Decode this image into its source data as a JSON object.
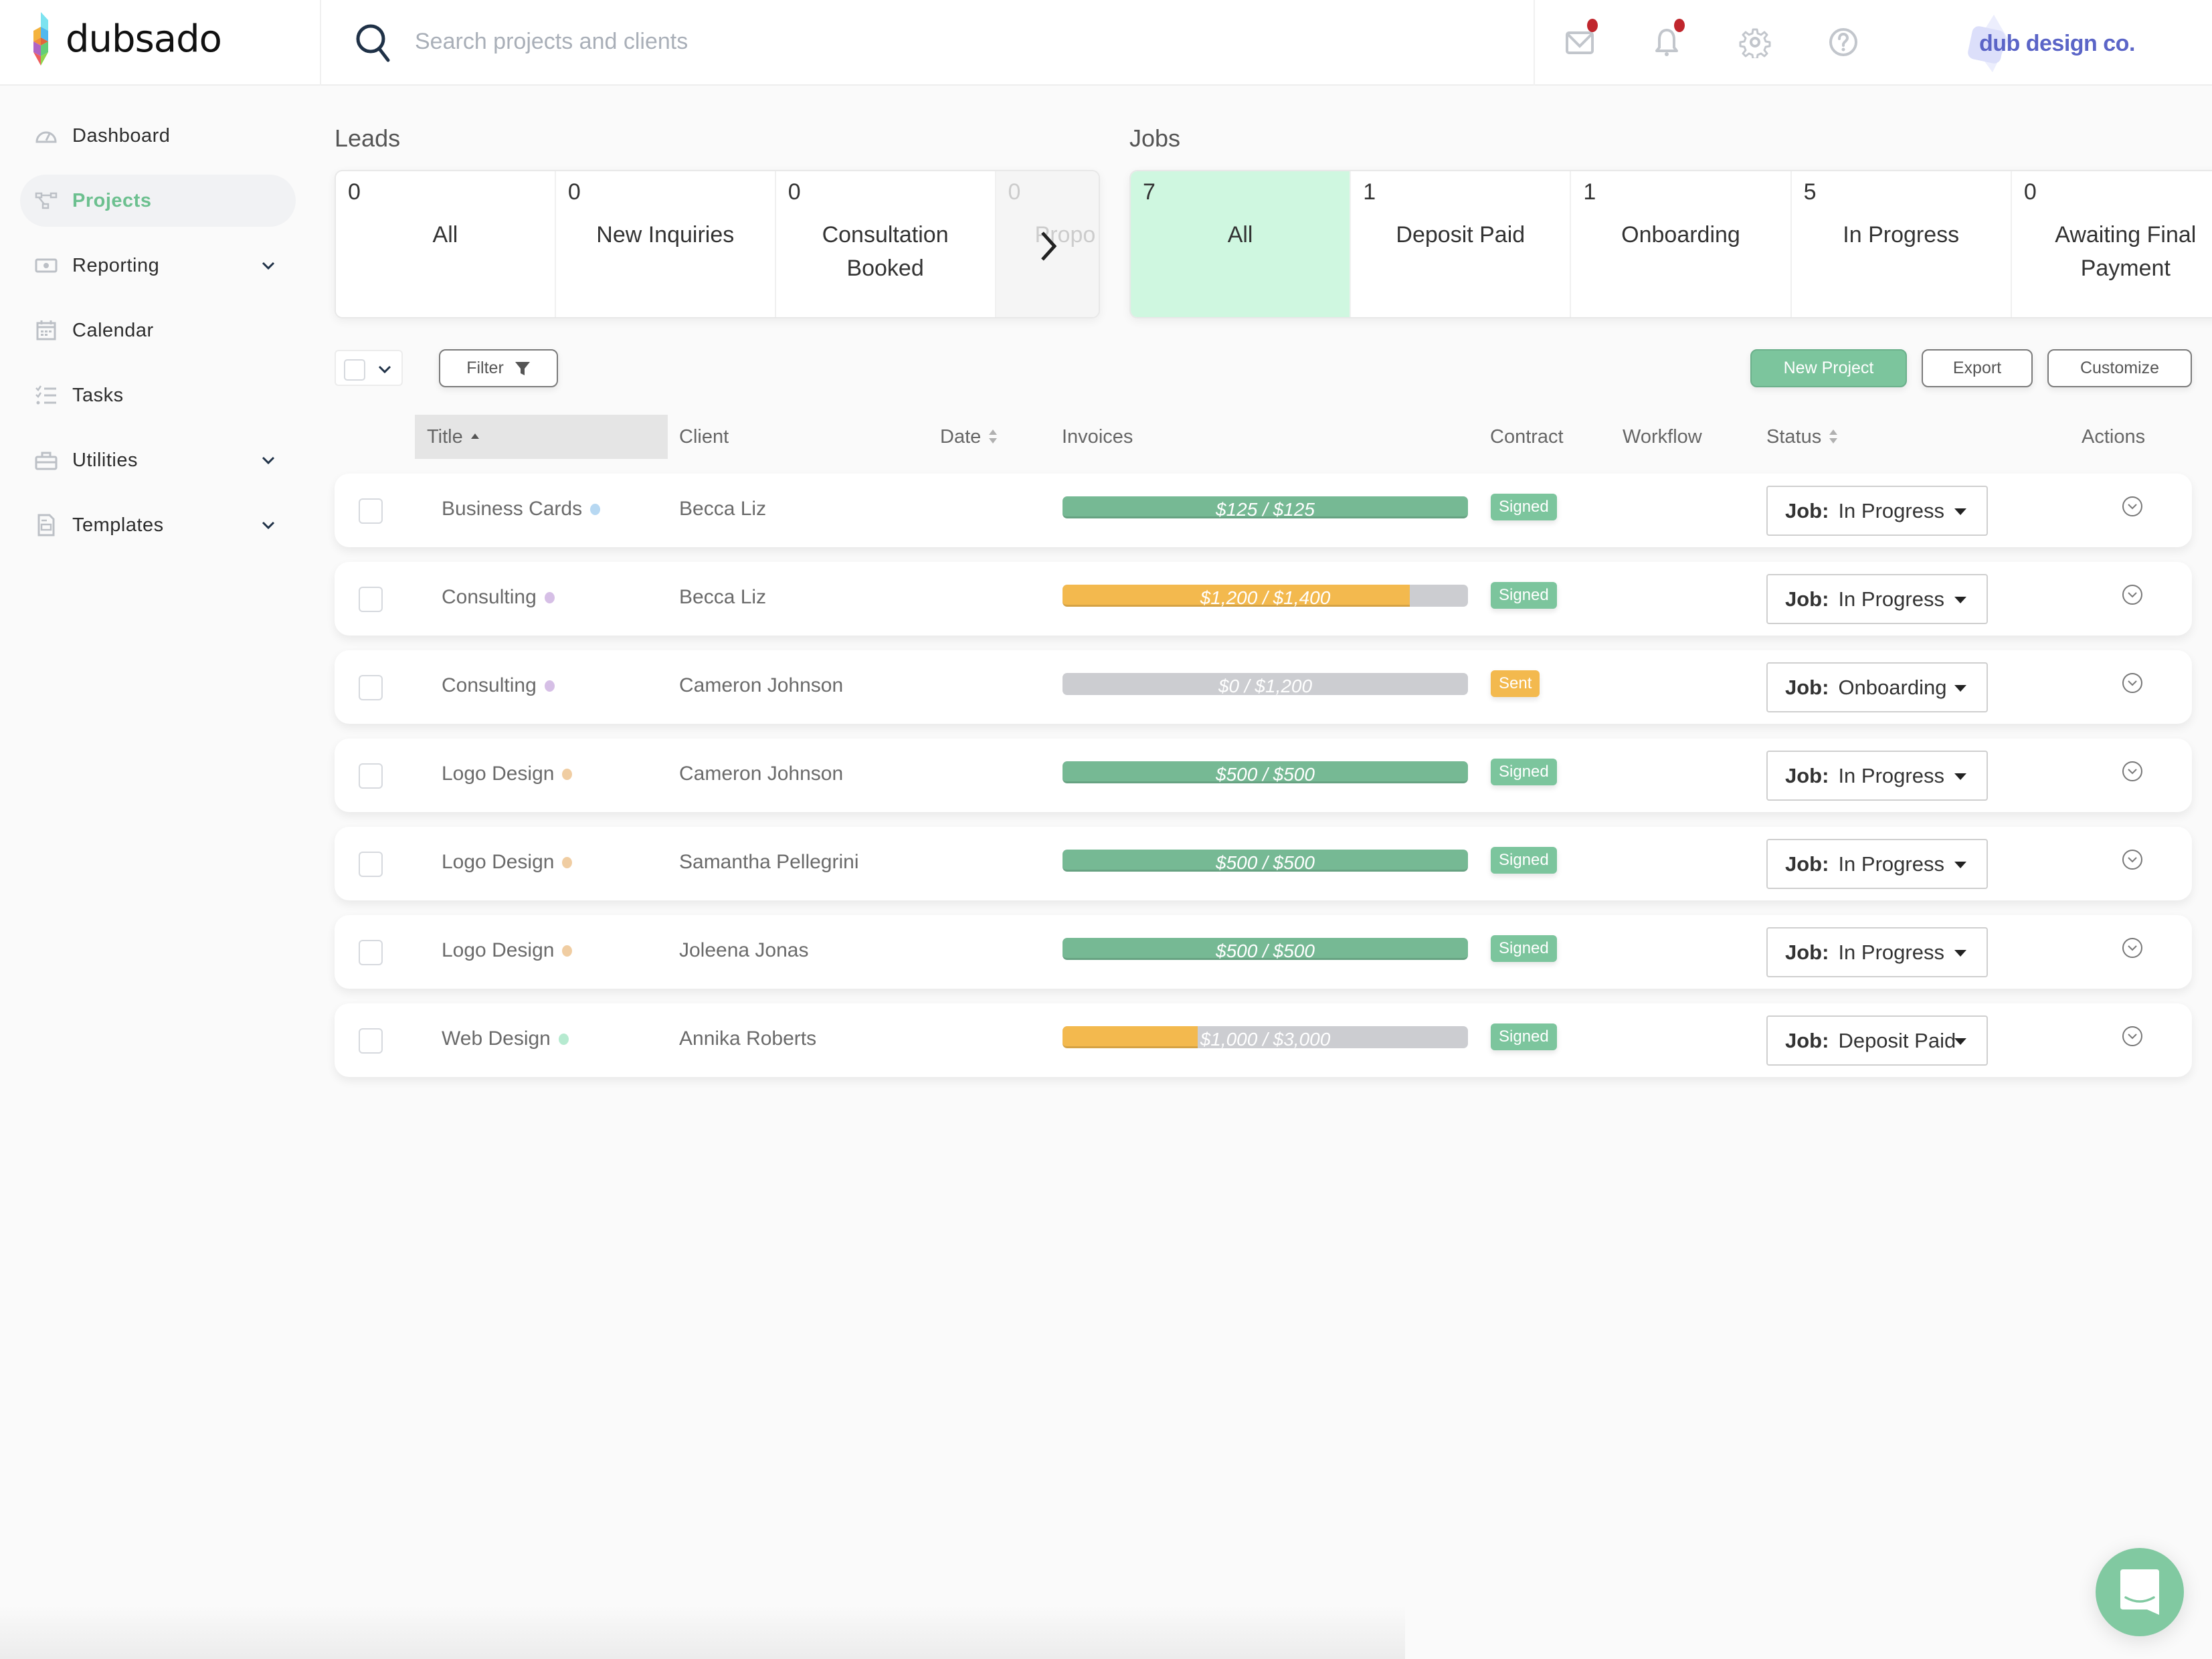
{
  "app": {
    "name": "dubsado",
    "brand_name": "dub design co.",
    "colors": {
      "accent": "#6cc08f",
      "primary_button": "#7cc59d",
      "selected_stage": "#cff7e0",
      "paid_full": "#76b994",
      "paid_partial": "#f3b94e",
      "unpaid": "#cccdd1",
      "notification_dot": "#c0262d",
      "brand_text": "#5b65c7"
    }
  },
  "header": {
    "search": {
      "placeholder": "Search projects and clients",
      "value": ""
    },
    "icons": [
      {
        "name": "mail-icon",
        "has_notification": true
      },
      {
        "name": "bell-icon",
        "has_notification": true
      },
      {
        "name": "gear-icon",
        "has_notification": false
      },
      {
        "name": "help-icon",
        "has_notification": false
      }
    ]
  },
  "sidebar": {
    "items": [
      {
        "label": "Dashboard",
        "icon": "dashboard-icon",
        "active": false,
        "expandable": false
      },
      {
        "label": "Projects",
        "icon": "projects-icon",
        "active": true,
        "expandable": false
      },
      {
        "label": "Reporting",
        "icon": "reporting-icon",
        "active": false,
        "expandable": true
      },
      {
        "label": "Calendar",
        "icon": "calendar-icon",
        "active": false,
        "expandable": false
      },
      {
        "label": "Tasks",
        "icon": "tasks-icon",
        "active": false,
        "expandable": false
      },
      {
        "label": "Utilities",
        "icon": "utilities-icon",
        "active": false,
        "expandable": true
      },
      {
        "label": "Templates",
        "icon": "templates-icon",
        "active": false,
        "expandable": true
      }
    ]
  },
  "leads": {
    "title": "Leads",
    "stages": [
      {
        "count": "0",
        "label": "All"
      },
      {
        "count": "0",
        "label": "New Inquiries"
      },
      {
        "count": "0",
        "label": "Consultation Booked"
      },
      {
        "count": "0",
        "label": "Propo"
      }
    ]
  },
  "jobs": {
    "title": "Jobs",
    "selected": "All",
    "stages": [
      {
        "count": "7",
        "label": "All"
      },
      {
        "count": "1",
        "label": "Deposit Paid"
      },
      {
        "count": "1",
        "label": "Onboarding"
      },
      {
        "count": "5",
        "label": "In Progress"
      },
      {
        "count": "0",
        "label": "Awaiting Final Payment"
      }
    ]
  },
  "toolbar": {
    "filter_label": "Filter",
    "new_project_label": "New Project",
    "export_label": "Export",
    "customize_label": "Customize"
  },
  "table": {
    "columns": {
      "title": "Title",
      "client": "Client",
      "date": "Date",
      "invoices": "Invoices",
      "contract": "Contract",
      "workflow": "Workflow",
      "status": "Status",
      "actions": "Actions"
    },
    "sort": {
      "column": "Title",
      "direction": "ascending"
    },
    "status_prefix": "Job:",
    "rows": [
      {
        "title": "Business Cards",
        "dot_color": "#b7d8f2",
        "client": "Becca Liz",
        "date": "",
        "invoice_text": "$125 / $125",
        "paid": 125,
        "total": 125,
        "contract": "Signed",
        "workflow": "",
        "status": "In Progress"
      },
      {
        "title": "Consulting",
        "dot_color": "#d6bfe6",
        "client": "Becca Liz",
        "date": "",
        "invoice_text": "$1,200 / $1,400",
        "paid": 1200,
        "total": 1400,
        "contract": "Signed",
        "workflow": "",
        "status": "In Progress"
      },
      {
        "title": "Consulting",
        "dot_color": "#d6bfe6",
        "client": "Cameron Johnson",
        "date": "",
        "invoice_text": "$0 / $1,200",
        "paid": 0,
        "total": 1200,
        "contract": "Sent",
        "workflow": "",
        "status": "Onboarding"
      },
      {
        "title": "Logo Design",
        "dot_color": "#f0cda2",
        "client": "Cameron Johnson",
        "date": "",
        "invoice_text": "$500 / $500",
        "paid": 500,
        "total": 500,
        "contract": "Signed",
        "workflow": "",
        "status": "In Progress"
      },
      {
        "title": "Logo Design",
        "dot_color": "#f0cda2",
        "client": "Samantha Pellegrini",
        "date": "",
        "invoice_text": "$500 / $500",
        "paid": 500,
        "total": 500,
        "contract": "Signed",
        "workflow": "",
        "status": "In Progress"
      },
      {
        "title": "Logo Design",
        "dot_color": "#f0cda2",
        "client": "Joleena Jonas",
        "date": "",
        "invoice_text": "$500 / $500",
        "paid": 500,
        "total": 500,
        "contract": "Signed",
        "workflow": "",
        "status": "In Progress"
      },
      {
        "title": "Web Design",
        "dot_color": "#b6ead0",
        "client": "Annika Roberts",
        "date": "",
        "invoice_text": "$1,000 / $3,000",
        "paid": 1000,
        "total": 3000,
        "contract": "Signed",
        "workflow": "",
        "status": "Deposit Paid"
      }
    ]
  },
  "chat": {
    "icon": "chat-icon"
  }
}
